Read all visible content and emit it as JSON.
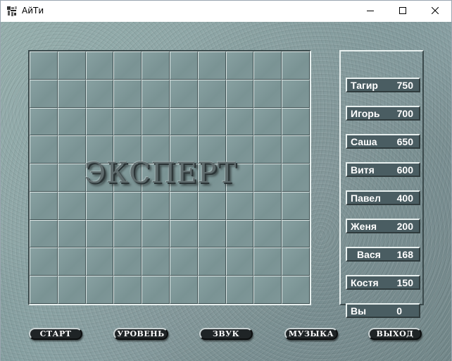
{
  "window": {
    "title": "АйТи"
  },
  "icons": {
    "app": "app-icon",
    "minimize": "minimize-icon",
    "maximize": "maximize-icon",
    "close": "close-icon"
  },
  "board": {
    "columns": 10,
    "rows": 9,
    "level_label": "ЭКСПЕРТ"
  },
  "scores": [
    {
      "name": "Тагир",
      "score": "750"
    },
    {
      "name": "Игорь",
      "score": "700"
    },
    {
      "name": "Саша",
      "score": "650"
    },
    {
      "name": "Витя",
      "score": "600"
    },
    {
      "name": "Павел",
      "score": "400"
    },
    {
      "name": "Женя",
      "score": "200"
    },
    {
      "name": "Вася",
      "score": "168"
    },
    {
      "name": "Костя",
      "score": "150"
    },
    {
      "name": "Вы",
      "score": "0"
    }
  ],
  "menu": {
    "start": "СТАРТ",
    "level": "УРОВЕНЬ",
    "sound": "ЗВУК",
    "music": "МУЗЫКА",
    "exit": "ВЫХОД"
  },
  "colors": {
    "background": "#8aa6a4",
    "score_field": "#4a5d62",
    "button": "#1f2426",
    "text_light": "#ffffff"
  }
}
